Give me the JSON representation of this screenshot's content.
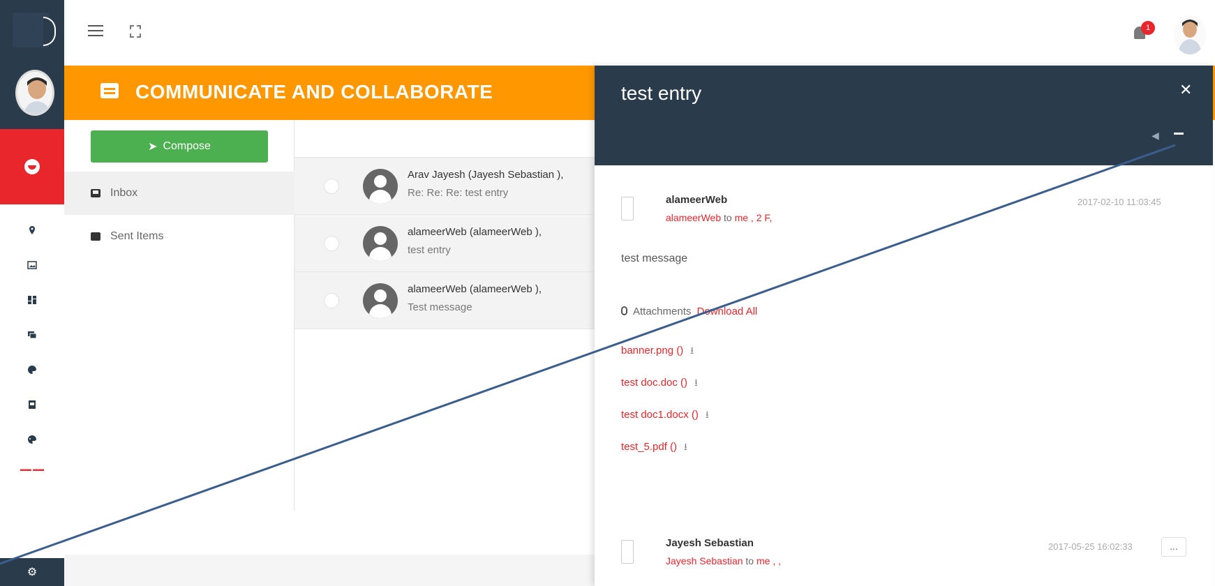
{
  "topbar": {
    "notification_count": "1"
  },
  "header": {
    "title": "COMMUNICATE AND COLLABORATE"
  },
  "folders": {
    "compose_label": "Compose",
    "items": [
      {
        "label": "Inbox"
      },
      {
        "label": "Sent Items"
      }
    ]
  },
  "messages": [
    {
      "from": "Arav Jayesh (Jayesh Sebastian ),",
      "subject": "Re: Re: Re: test entry"
    },
    {
      "from": "alameerWeb (alameerWeb ),",
      "subject": "test entry"
    },
    {
      "from": "alameerWeb (alameerWeb ),",
      "subject": "Test message"
    }
  ],
  "detail": {
    "title": "test entry",
    "thread": [
      {
        "sender": "alameerWeb",
        "to_from": "alameerWeb",
        "to_word": "to",
        "to_rest": "me , 2 F,",
        "date": "2017-02-10 11:03:45",
        "body": "test message",
        "attachments_label": "Attachments",
        "download_all": "Download All",
        "attachments": [
          "banner.png ()",
          "test doc.doc ()",
          "test doc1.docx ()",
          "test_5.pdf ()"
        ]
      },
      {
        "sender": "Jayesh Sebastian",
        "to_from": "Jayesh Sebastian",
        "to_word": "to",
        "to_rest": "me , ,",
        "date": "2017-05-25 16:02:33",
        "more": "..."
      }
    ]
  },
  "colors": {
    "rail_dark": "#2a3b4c",
    "accent_red": "#e8262b",
    "header_orange": "#ff9800",
    "compose_green": "#4caf50",
    "annotation_line": "#3b5e8c"
  }
}
